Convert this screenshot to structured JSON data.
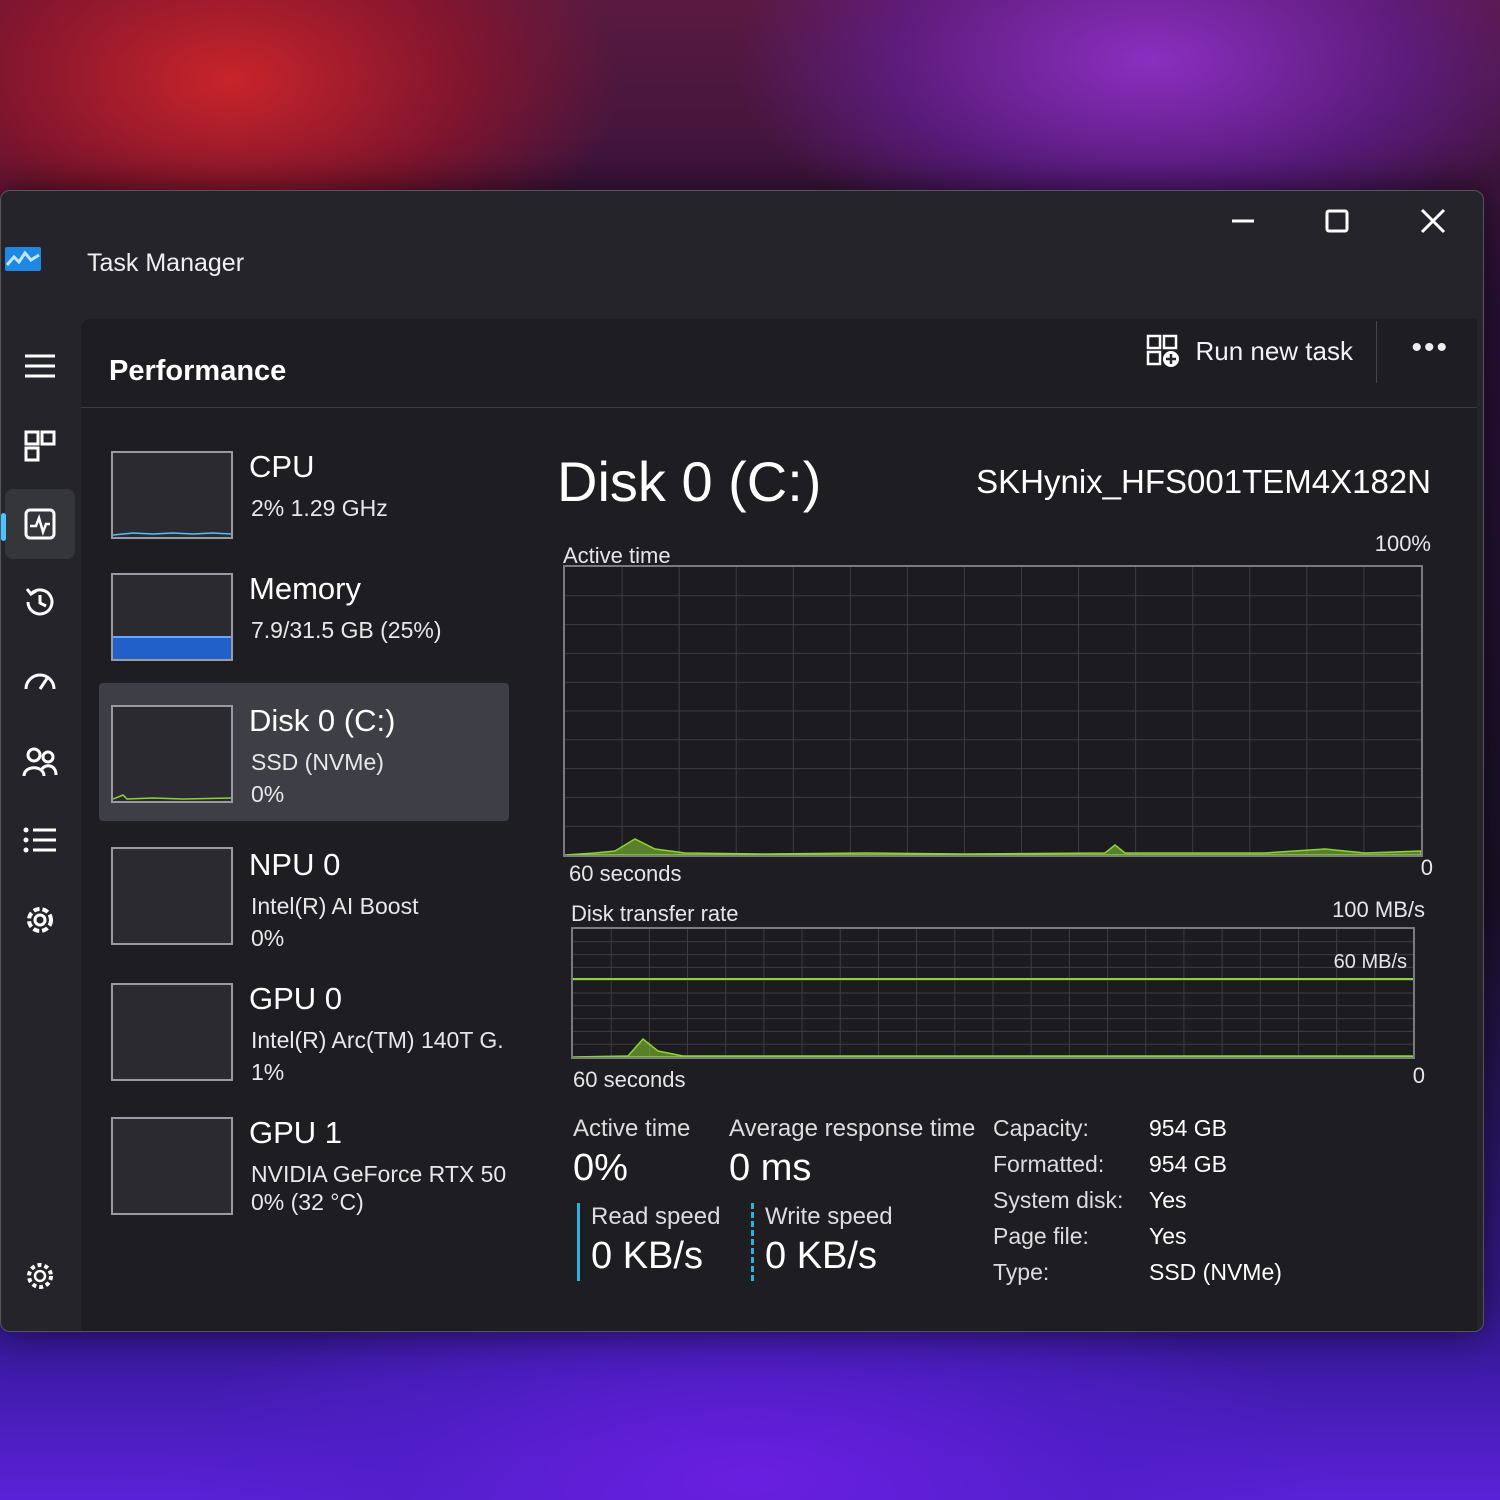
{
  "window": {
    "title": "Task Manager"
  },
  "header": {
    "title": "Performance",
    "run_task_label": "Run new task",
    "more_label": "•••"
  },
  "devices": [
    {
      "name": "CPU",
      "line1": "2%  1.29 GHz",
      "line2": ""
    },
    {
      "name": "Memory",
      "line1": "7.9/31.5 GB (25%)",
      "line2": ""
    },
    {
      "name": "Disk 0 (C:)",
      "line1": "SSD (NVMe)",
      "line2": "0%"
    },
    {
      "name": "NPU 0",
      "line1": "Intel(R) AI Boost",
      "line2": "0%"
    },
    {
      "name": "GPU 0",
      "line1": "Intel(R) Arc(TM) 140T G.",
      "line2": "1%"
    },
    {
      "name": "GPU 1",
      "line1": "NVIDIA GeForce RTX 50",
      "line2": "0% (32 °C)"
    }
  ],
  "memory_fill_fraction": 0.25,
  "detail": {
    "title": "Disk 0 (C:)",
    "model": "SKHynix_HFS001TEM4X182N",
    "active_graph": {
      "label": "Active time",
      "max": "100%",
      "duration": "60 seconds",
      "min": "0"
    },
    "transfer_graph": {
      "label": "Disk transfer rate",
      "max": "100 MB/s",
      "mid": "60 MB/s",
      "duration": "60 seconds",
      "min": "0"
    },
    "stats": {
      "active_time_label": "Active time",
      "active_time_value": "0%",
      "avg_response_label": "Average response time",
      "avg_response_value": "0 ms",
      "read_label": "Read speed",
      "read_value": "0 KB/s",
      "write_label": "Write speed",
      "write_value": "0 KB/s"
    },
    "props": [
      {
        "key": "Capacity:",
        "value": "954 GB"
      },
      {
        "key": "Formatted:",
        "value": "954 GB"
      },
      {
        "key": "System disk:",
        "value": "Yes"
      },
      {
        "key": "Page file:",
        "value": "Yes"
      },
      {
        "key": "Type:",
        "value": "SSD (NVMe)"
      }
    ]
  },
  "colors": {
    "accent": "#4cc2ff",
    "graph_line": "#8cd232",
    "memory_fill": "#2060c8",
    "window_bg": "#24242a"
  },
  "nav_icons": [
    "menu-icon",
    "processes-icon",
    "performance-icon",
    "app-history-icon",
    "startup-apps-icon",
    "users-icon",
    "details-icon",
    "services-icon",
    "settings-icon"
  ]
}
